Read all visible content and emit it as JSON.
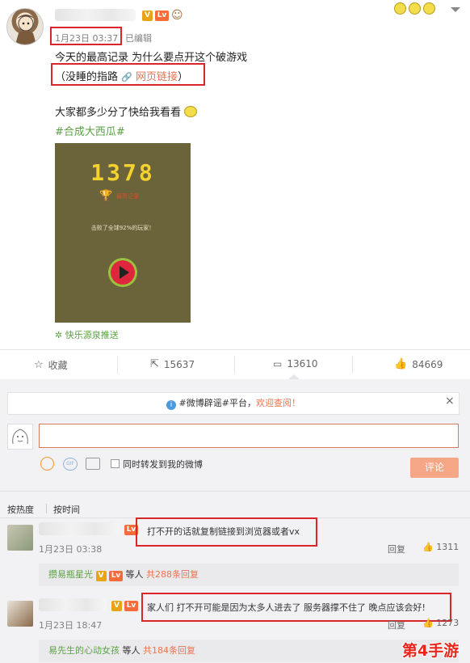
{
  "post": {
    "timestamp": "1月23日 03:37",
    "edited": "已编辑",
    "line1": "今天的最高记录 为什么要点开这个破游戏",
    "link_prefix": "（没睡的指路",
    "link_icon": "link-icon",
    "link_label": "网页链接",
    "link_suffix": "）",
    "line3": "大家都多少分了快给我看看",
    "hashtag": "#合成大西瓜#",
    "source": "快乐源泉推送",
    "badge_v": "V",
    "badge_lv": "Lv"
  },
  "game": {
    "score": "1378",
    "best_label": "最高记录",
    "beat_text": "击败了全球92%的玩家！"
  },
  "actions": {
    "favorite": "收藏",
    "repost_count": "15637",
    "comment_count": "13610",
    "like_count": "84669"
  },
  "notice": {
    "text_prefix": "#微博辟谣#平台，",
    "text_link": "欢迎查阅！",
    "close": "×"
  },
  "composer": {
    "placeholder": "",
    "repost_label": "同时转发到我的微博",
    "submit": "评论"
  },
  "sort": {
    "hot": "按热度",
    "time": "按时间"
  },
  "comments": [
    {
      "text": "打不开的话就复制链接到浏览器或者vx",
      "time": "1月23日 03:38",
      "reply_label": "回复",
      "likes": "1311",
      "replier": "攒易瓶星光",
      "replies_middle": "等人",
      "replies_count": "共288条回复"
    },
    {
      "text": "家人们 打不开可能是因为太多人进去了 服务器撑不住了 晚点应该会好!",
      "time": "1月23日 18:47",
      "reply_label": "回复",
      "likes": "1273",
      "replier": "易先生的心动女孩",
      "replies_middle": "等人",
      "replies_count": "共184条回复"
    }
  ],
  "watermark": "第4手游",
  "colors": {
    "brand_orange": "#eb7350",
    "hashtag_green": "#5aa142",
    "highlight_red": "#d9262b",
    "game_bg": "#6b6339",
    "score_yellow": "#f3d22f"
  }
}
